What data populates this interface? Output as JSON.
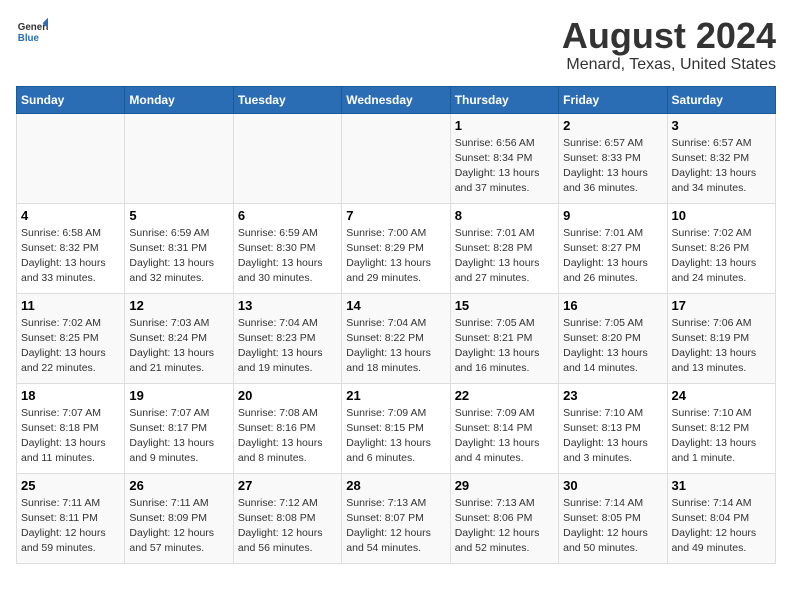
{
  "header": {
    "logo_general": "General",
    "logo_blue": "Blue",
    "main_title": "August 2024",
    "subtitle": "Menard, Texas, United States"
  },
  "calendar": {
    "days_of_week": [
      "Sunday",
      "Monday",
      "Tuesday",
      "Wednesday",
      "Thursday",
      "Friday",
      "Saturday"
    ],
    "weeks": [
      {
        "days": [
          {
            "number": "",
            "info": ""
          },
          {
            "number": "",
            "info": ""
          },
          {
            "number": "",
            "info": ""
          },
          {
            "number": "",
            "info": ""
          },
          {
            "number": "1",
            "info": "Sunrise: 6:56 AM\nSunset: 8:34 PM\nDaylight: 13 hours\nand 37 minutes."
          },
          {
            "number": "2",
            "info": "Sunrise: 6:57 AM\nSunset: 8:33 PM\nDaylight: 13 hours\nand 36 minutes."
          },
          {
            "number": "3",
            "info": "Sunrise: 6:57 AM\nSunset: 8:32 PM\nDaylight: 13 hours\nand 34 minutes."
          }
        ]
      },
      {
        "days": [
          {
            "number": "4",
            "info": "Sunrise: 6:58 AM\nSunset: 8:32 PM\nDaylight: 13 hours\nand 33 minutes."
          },
          {
            "number": "5",
            "info": "Sunrise: 6:59 AM\nSunset: 8:31 PM\nDaylight: 13 hours\nand 32 minutes."
          },
          {
            "number": "6",
            "info": "Sunrise: 6:59 AM\nSunset: 8:30 PM\nDaylight: 13 hours\nand 30 minutes."
          },
          {
            "number": "7",
            "info": "Sunrise: 7:00 AM\nSunset: 8:29 PM\nDaylight: 13 hours\nand 29 minutes."
          },
          {
            "number": "8",
            "info": "Sunrise: 7:01 AM\nSunset: 8:28 PM\nDaylight: 13 hours\nand 27 minutes."
          },
          {
            "number": "9",
            "info": "Sunrise: 7:01 AM\nSunset: 8:27 PM\nDaylight: 13 hours\nand 26 minutes."
          },
          {
            "number": "10",
            "info": "Sunrise: 7:02 AM\nSunset: 8:26 PM\nDaylight: 13 hours\nand 24 minutes."
          }
        ]
      },
      {
        "days": [
          {
            "number": "11",
            "info": "Sunrise: 7:02 AM\nSunset: 8:25 PM\nDaylight: 13 hours\nand 22 minutes."
          },
          {
            "number": "12",
            "info": "Sunrise: 7:03 AM\nSunset: 8:24 PM\nDaylight: 13 hours\nand 21 minutes."
          },
          {
            "number": "13",
            "info": "Sunrise: 7:04 AM\nSunset: 8:23 PM\nDaylight: 13 hours\nand 19 minutes."
          },
          {
            "number": "14",
            "info": "Sunrise: 7:04 AM\nSunset: 8:22 PM\nDaylight: 13 hours\nand 18 minutes."
          },
          {
            "number": "15",
            "info": "Sunrise: 7:05 AM\nSunset: 8:21 PM\nDaylight: 13 hours\nand 16 minutes."
          },
          {
            "number": "16",
            "info": "Sunrise: 7:05 AM\nSunset: 8:20 PM\nDaylight: 13 hours\nand 14 minutes."
          },
          {
            "number": "17",
            "info": "Sunrise: 7:06 AM\nSunset: 8:19 PM\nDaylight: 13 hours\nand 13 minutes."
          }
        ]
      },
      {
        "days": [
          {
            "number": "18",
            "info": "Sunrise: 7:07 AM\nSunset: 8:18 PM\nDaylight: 13 hours\nand 11 minutes."
          },
          {
            "number": "19",
            "info": "Sunrise: 7:07 AM\nSunset: 8:17 PM\nDaylight: 13 hours\nand 9 minutes."
          },
          {
            "number": "20",
            "info": "Sunrise: 7:08 AM\nSunset: 8:16 PM\nDaylight: 13 hours\nand 8 minutes."
          },
          {
            "number": "21",
            "info": "Sunrise: 7:09 AM\nSunset: 8:15 PM\nDaylight: 13 hours\nand 6 minutes."
          },
          {
            "number": "22",
            "info": "Sunrise: 7:09 AM\nSunset: 8:14 PM\nDaylight: 13 hours\nand 4 minutes."
          },
          {
            "number": "23",
            "info": "Sunrise: 7:10 AM\nSunset: 8:13 PM\nDaylight: 13 hours\nand 3 minutes."
          },
          {
            "number": "24",
            "info": "Sunrise: 7:10 AM\nSunset: 8:12 PM\nDaylight: 13 hours\nand 1 minute."
          }
        ]
      },
      {
        "days": [
          {
            "number": "25",
            "info": "Sunrise: 7:11 AM\nSunset: 8:11 PM\nDaylight: 12 hours\nand 59 minutes."
          },
          {
            "number": "26",
            "info": "Sunrise: 7:11 AM\nSunset: 8:09 PM\nDaylight: 12 hours\nand 57 minutes."
          },
          {
            "number": "27",
            "info": "Sunrise: 7:12 AM\nSunset: 8:08 PM\nDaylight: 12 hours\nand 56 minutes."
          },
          {
            "number": "28",
            "info": "Sunrise: 7:13 AM\nSunset: 8:07 PM\nDaylight: 12 hours\nand 54 minutes."
          },
          {
            "number": "29",
            "info": "Sunrise: 7:13 AM\nSunset: 8:06 PM\nDaylight: 12 hours\nand 52 minutes."
          },
          {
            "number": "30",
            "info": "Sunrise: 7:14 AM\nSunset: 8:05 PM\nDaylight: 12 hours\nand 50 minutes."
          },
          {
            "number": "31",
            "info": "Sunrise: 7:14 AM\nSunset: 8:04 PM\nDaylight: 12 hours\nand 49 minutes."
          }
        ]
      }
    ]
  }
}
